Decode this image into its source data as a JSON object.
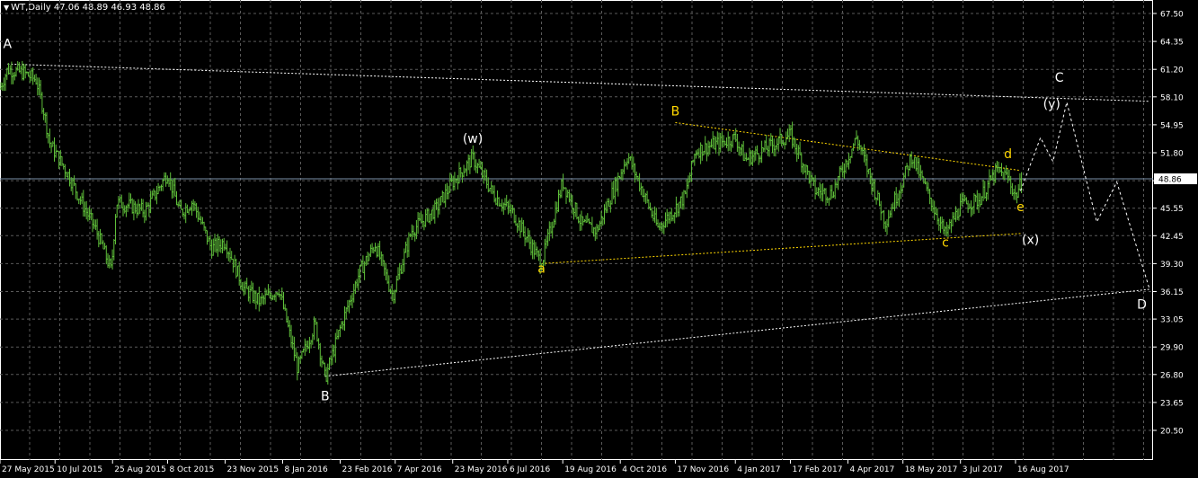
{
  "header": {
    "symbol": "WT,Daily",
    "ohlc": "47.06 48.89 46.93 48.86"
  },
  "chart_data": {
    "type": "line",
    "xlabel": "",
    "ylabel": "",
    "ylim": [
      20.5,
      69.0
    ],
    "grid": true,
    "y_ticks": [
      "67.50",
      "64.35",
      "61.20",
      "58.10",
      "54.95",
      "51.80",
      "48.65",
      "45.55",
      "42.45",
      "39.30",
      "36.15",
      "33.05",
      "29.90",
      "26.80",
      "23.65",
      "20.50"
    ],
    "x_ticks": [
      "27 May 2015",
      "10 Jul 2015",
      "25 Aug 2015",
      "8 Oct 2015",
      "23 Nov 2015",
      "8 Jan 2016",
      "23 Feb 2016",
      "7 Apr 2016",
      "23 May 2016",
      "6 Jul 2016",
      "19 Aug 2016",
      "4 Oct 2016",
      "17 Nov 2016",
      "4 Jan 2017",
      "17 Feb 2017",
      "4 Apr 2017",
      "18 May 2017",
      "3 Jul 2017",
      "16 Aug 2017"
    ],
    "current_price": "48.86",
    "series": [
      {
        "values": [
          {
            "x": "27 May 2015",
            "y": 59.0
          },
          {
            "x": "2 Jun 2015",
            "y": 61.2
          },
          {
            "x": "15 Jun 2015",
            "y": 60.8
          },
          {
            "x": "25 Jun 2015",
            "y": 60.0
          },
          {
            "x": "1 Jul 2015",
            "y": 56.5
          },
          {
            "x": "6 Jul 2015",
            "y": 52.8
          },
          {
            "x": "20 Jul 2015",
            "y": 49.5
          },
          {
            "x": "1 Aug 2015",
            "y": 46.0
          },
          {
            "x": "12 Aug 2015",
            "y": 43.0
          },
          {
            "x": "24 Aug 2015",
            "y": 38.5
          },
          {
            "x": "28 Aug 2015",
            "y": 46.2
          },
          {
            "x": "8 Sep 2015",
            "y": 45.8
          },
          {
            "x": "20 Sep 2015",
            "y": 45.2
          },
          {
            "x": "8 Oct 2015",
            "y": 49.5
          },
          {
            "x": "18 Oct 2015",
            "y": 45.0
          },
          {
            "x": "28 Oct 2015",
            "y": 46.3
          },
          {
            "x": "12 Nov 2015",
            "y": 41.0
          },
          {
            "x": "23 Nov 2015",
            "y": 41.8
          },
          {
            "x": "8 Dec 2015",
            "y": 36.5
          },
          {
            "x": "21 Dec 2015",
            "y": 35.0
          },
          {
            "x": "5 Jan 2016",
            "y": 36.5
          },
          {
            "x": "20 Jan 2016",
            "y": 27.5
          },
          {
            "x": "3 Feb 2016",
            "y": 32.5
          },
          {
            "x": "11 Feb 2016",
            "y": 26.3
          },
          {
            "x": "23 Feb 2016",
            "y": 32.0
          },
          {
            "x": "10 Mar 2016",
            "y": 38.5
          },
          {
            "x": "22 Mar 2016",
            "y": 41.5
          },
          {
            "x": "5 Apr 2016",
            "y": 35.7
          },
          {
            "x": "20 Apr 2016",
            "y": 43.0
          },
          {
            "x": "10 May 2016",
            "y": 45.5
          },
          {
            "x": "23 May 2016",
            "y": 48.5
          },
          {
            "x": "8 Jun 2016",
            "y": 51.2
          },
          {
            "x": "25 Jun 2016",
            "y": 47.0
          },
          {
            "x": "10 Jul 2016",
            "y": 45.0
          },
          {
            "x": "2 Aug 2016",
            "y": 39.3
          },
          {
            "x": "19 Aug 2016",
            "y": 48.5
          },
          {
            "x": "3 Sep 2016",
            "y": 43.8
          },
          {
            "x": "15 Sep 2016",
            "y": 43.0
          },
          {
            "x": "10 Oct 2016",
            "y": 51.5
          },
          {
            "x": "3 Nov 2016",
            "y": 43.3
          },
          {
            "x": "17 Nov 2016",
            "y": 45.5
          },
          {
            "x": "25 Nov 2016",
            "y": 47.0
          },
          {
            "x": "3 Dec 2016",
            "y": 52.0
          },
          {
            "x": "4 Jan 2017",
            "y": 53.5
          },
          {
            "x": "12 Jan 2017",
            "y": 51.0
          },
          {
            "x": "17 Feb 2017",
            "y": 53.8
          },
          {
            "x": "9 Mar 2017",
            "y": 47.5
          },
          {
            "x": "22 Mar 2017",
            "y": 47.2
          },
          {
            "x": "11 Apr 2017",
            "y": 53.5
          },
          {
            "x": "4 May 2017",
            "y": 44.0
          },
          {
            "x": "18 May 2017",
            "y": 48.7
          },
          {
            "x": "25 May 2017",
            "y": 51.5
          },
          {
            "x": "21 Jun 2017",
            "y": 42.5
          },
          {
            "x": "3 Jul 2017",
            "y": 45.8
          },
          {
            "x": "18 Jul 2017",
            "y": 46.5
          },
          {
            "x": "1 Aug 2017",
            "y": 49.8
          },
          {
            "x": "10 Aug 2017",
            "y": 49.0
          },
          {
            "x": "16 Aug 2017",
            "y": 46.9
          },
          {
            "x": "22 Aug 2017",
            "y": 48.86
          }
        ]
      }
    ],
    "annotations": [
      {
        "text": "A",
        "x": "2 Jun 2015",
        "y": 63.6,
        "color": "#ffffff"
      },
      {
        "text": "B",
        "x": "11 Feb 2016",
        "y": 23.9,
        "color": "#ffffff"
      },
      {
        "text": "(w)",
        "x": "8 Jun 2016",
        "y": 52.9,
        "color": "#ffffff"
      },
      {
        "text": "a",
        "x": "2 Aug 2016",
        "y": 38.3,
        "color": "#ffd700"
      },
      {
        "text": "B",
        "x": "17 Nov 2016",
        "y": 56.0,
        "color": "#ffd700"
      },
      {
        "text": "c",
        "x": "21 Jun 2017",
        "y": 41.2,
        "color": "#ffd700"
      },
      {
        "text": "d",
        "x": "10 Aug 2017",
        "y": 51.2,
        "color": "#ffd700"
      },
      {
        "text": "e",
        "x": "20 Aug 2017",
        "y": 45.2,
        "color": "#ffd700"
      },
      {
        "text": "(x)",
        "x": "28 Aug 2017",
        "y": 41.5,
        "color": "#ffffff"
      },
      {
        "text": "(y)",
        "x": "14 Sep 2017",
        "y": 56.8,
        "color": "#ffffff"
      },
      {
        "text": "C",
        "x": "20 Sep 2017",
        "y": 59.8,
        "color": "#ffffff"
      },
      {
        "text": "D",
        "x": "25 Nov 2017",
        "y": 34.2,
        "color": "#ffffff"
      }
    ],
    "trendlines": [
      {
        "from": {
          "x": "2 Jun 2015",
          "y": 61.8
        },
        "to": {
          "x": "1 Dec 2017",
          "y": 57.6
        },
        "color": "#ffffff"
      },
      {
        "from": {
          "x": "11 Feb 2016",
          "y": 26.6
        },
        "to": {
          "x": "1 Dec 2017",
          "y": 36.4
        },
        "color": "#ffffff"
      },
      {
        "from": {
          "x": "2 Aug 2016",
          "y": 39.3
        },
        "to": {
          "x": "20 Aug 2017",
          "y": 42.7
        },
        "color": "#ffd700"
      },
      {
        "from": {
          "x": "17 Nov 2016",
          "y": 55.2
        },
        "to": {
          "x": "20 Aug 2017",
          "y": 49.8
        },
        "color": "#ffd700"
      }
    ],
    "projection": [
      {
        "x": "20 Aug 2017",
        "y": 47.5
      },
      {
        "x": "5 Sep 2017",
        "y": 53.5
      },
      {
        "x": "15 Sep 2017",
        "y": 50.8
      },
      {
        "x": "26 Sep 2017",
        "y": 57.5
      },
      {
        "x": "20 Oct 2017",
        "y": 44.0
      },
      {
        "x": "5 Nov 2017",
        "y": 48.5
      },
      {
        "x": "1 Dec 2017",
        "y": 36.5
      }
    ]
  }
}
